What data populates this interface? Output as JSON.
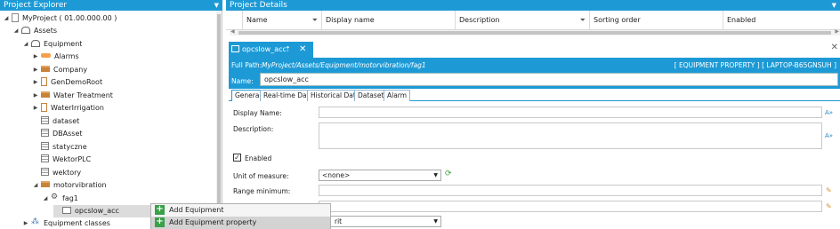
{
  "explorer": {
    "title": "Project Explorer",
    "tree": [
      {
        "label": "MyProject ( 01.00.000.00 )",
        "icon": "project-icon"
      },
      {
        "label": "Assets",
        "icon": "assets-icon"
      },
      {
        "label": "Equipment",
        "icon": "equipment-icon"
      },
      {
        "label": "Alarms",
        "icon": "alarm-icon"
      },
      {
        "label": "Company",
        "icon": "folder-icon"
      },
      {
        "label": "GenDemoRoot",
        "icon": "generator-icon"
      },
      {
        "label": "Water Treatment",
        "icon": "folder-icon"
      },
      {
        "label": "WaterIrrigation",
        "icon": "generator-icon"
      },
      {
        "label": "dataset",
        "icon": "grid-icon"
      },
      {
        "label": "DBAsset",
        "icon": "grid-icon"
      },
      {
        "label": "statyczne",
        "icon": "grid-icon"
      },
      {
        "label": "WektorPLC",
        "icon": "grid-icon"
      },
      {
        "label": "wektory",
        "icon": "grid-icon"
      },
      {
        "label": "motorvibration",
        "icon": "folder-icon"
      },
      {
        "label": "fag1",
        "icon": "equipment-node-icon"
      },
      {
        "label": "opcslow_acc",
        "icon": "property-icon"
      },
      {
        "label": "Equipment classes",
        "icon": "classes-icon"
      }
    ]
  },
  "details": {
    "title": "Project Details",
    "columns": [
      "Name",
      "Display name",
      "Description",
      "Sorting order",
      "Enabled"
    ]
  },
  "document": {
    "tab_label": "opcslow_acc",
    "full_path_label": "Full Path:",
    "full_path_value": "MyProject/Assets/Equipment/motorvibration/fag1",
    "type_info": "[ EQUIPMENT PROPERTY ] [ LAPTOP-B65GNSUH ]",
    "name_label": "Name:",
    "name_value": "opcslow_acc",
    "subtabs": [
      "General",
      "Real-time Data",
      "Historical Data",
      "Dataset",
      "Alarm"
    ],
    "form": {
      "display_name_label": "Display Name:",
      "description_label": "Description:",
      "enabled_label": "Enabled",
      "unit_label": "Unit of measure:",
      "unit_value": "<none>",
      "range_min_label": "Range minimum:",
      "bottom_select_value": "rit",
      "ab_label": "A»"
    }
  },
  "context_menu": {
    "items": [
      "Add Equipment",
      "Add Equipment property"
    ]
  },
  "colors": {
    "accent": "#1d9ad6",
    "add_green": "#3aa04a"
  }
}
